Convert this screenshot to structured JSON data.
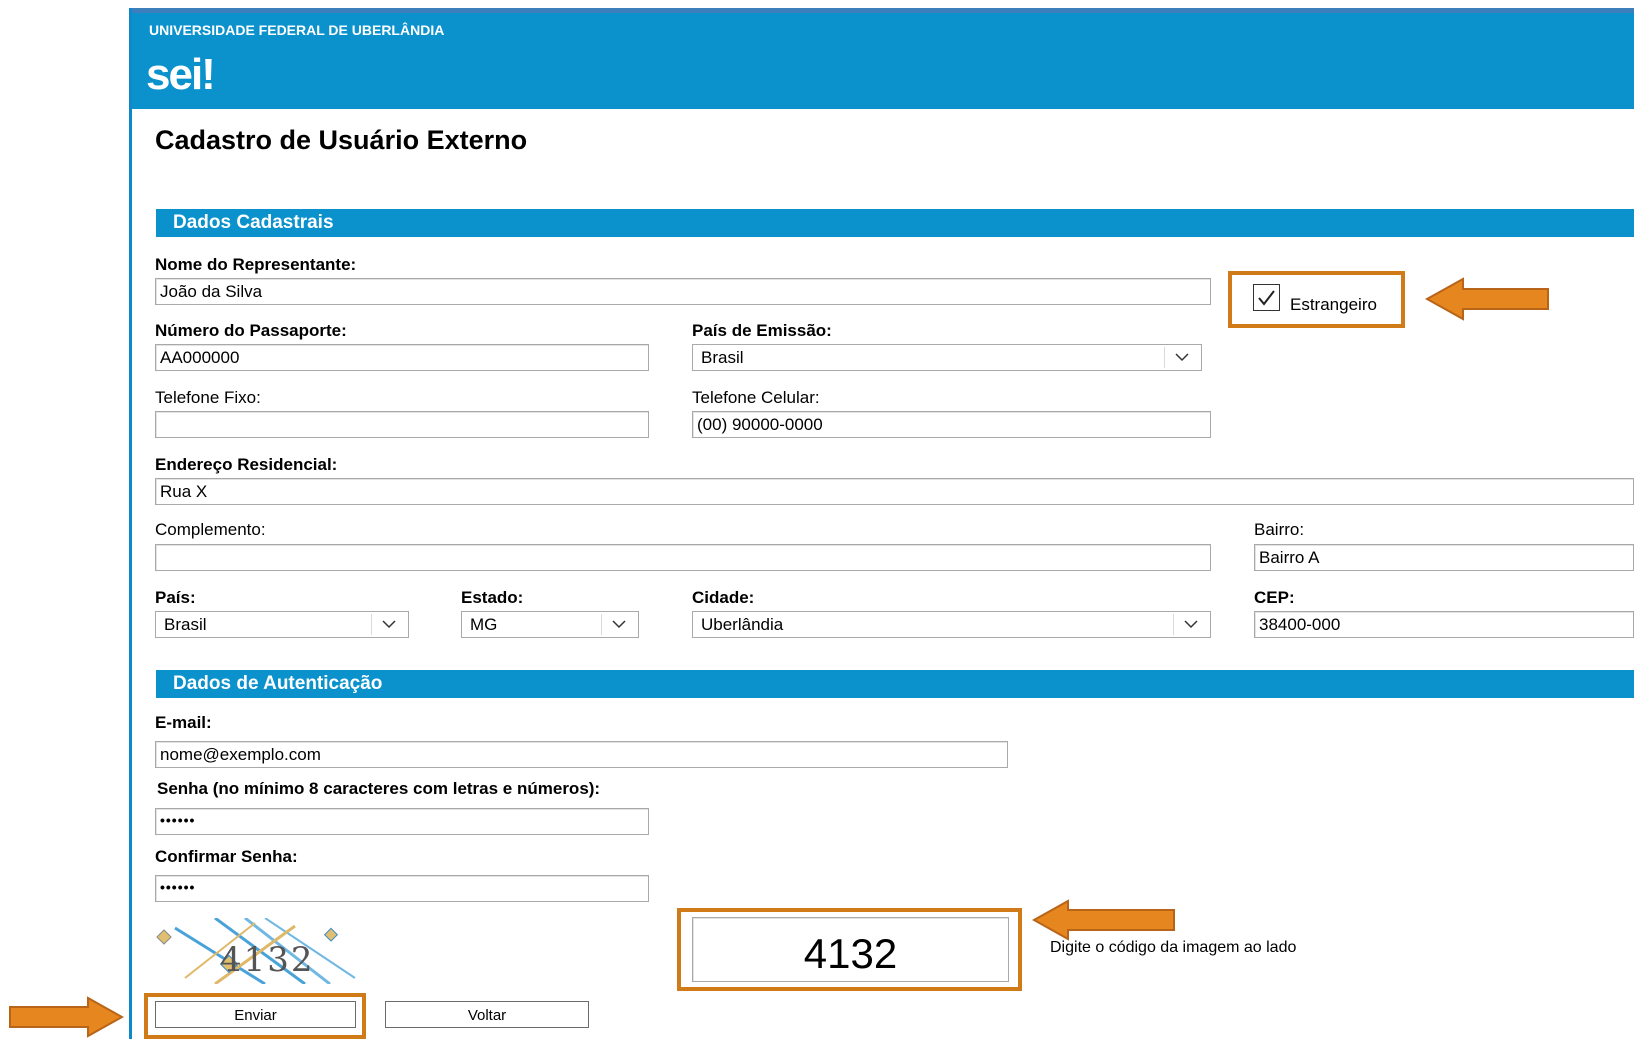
{
  "header": {
    "university": "UNIVERSIDADE FEDERAL DE UBERLÂNDIA",
    "logo": "sei!"
  },
  "page_title": "Cadastro de Usuário Externo",
  "sections": {
    "dados_cadastrais": "Dados Cadastrais",
    "dados_autenticacao": "Dados de Autenticação"
  },
  "form": {
    "nome_label": "Nome do Representante:",
    "nome_value": "João da Silva",
    "estrangeiro_label": "Estrangeiro",
    "estrangeiro_checked": true,
    "passaporte_label": "Número do Passaporte:",
    "passaporte_value": "AA000000",
    "pais_emissao_label": "País de Emissão:",
    "pais_emissao_value": "Brasil",
    "telefone_fixo_label": "Telefone Fixo:",
    "telefone_fixo_value": "",
    "telefone_celular_label": "Telefone Celular:",
    "telefone_celular_value": "(00) 90000-0000",
    "endereco_label": "Endereço Residencial:",
    "endereco_value": "Rua X",
    "complemento_label": "Complemento:",
    "complemento_value": "",
    "bairro_label": "Bairro:",
    "bairro_value": "Bairro A",
    "pais_label": "País:",
    "pais_value": "Brasil",
    "estado_label": "Estado:",
    "estado_value": "MG",
    "cidade_label": "Cidade:",
    "cidade_value": "Uberlândia",
    "cep_label": "CEP:",
    "cep_value": "38400-000",
    "email_label": "E-mail:",
    "email_value": "nome@exemplo.com",
    "senha_label": "Senha (no mínimo 8 caracteres com letras e números):",
    "senha_value": "••••••",
    "confirmar_label": "Confirmar Senha:",
    "confirmar_value": "••••••"
  },
  "captcha": {
    "image_text": "4132",
    "input_value": "4132",
    "hint": "Digite o código da imagem ao lado"
  },
  "buttons": {
    "enviar": "Enviar",
    "voltar": "Voltar"
  },
  "colors": {
    "header_blue": "#0b92cd",
    "highlight_orange": "#d07b17",
    "arrow_orange": "#e6861e"
  }
}
